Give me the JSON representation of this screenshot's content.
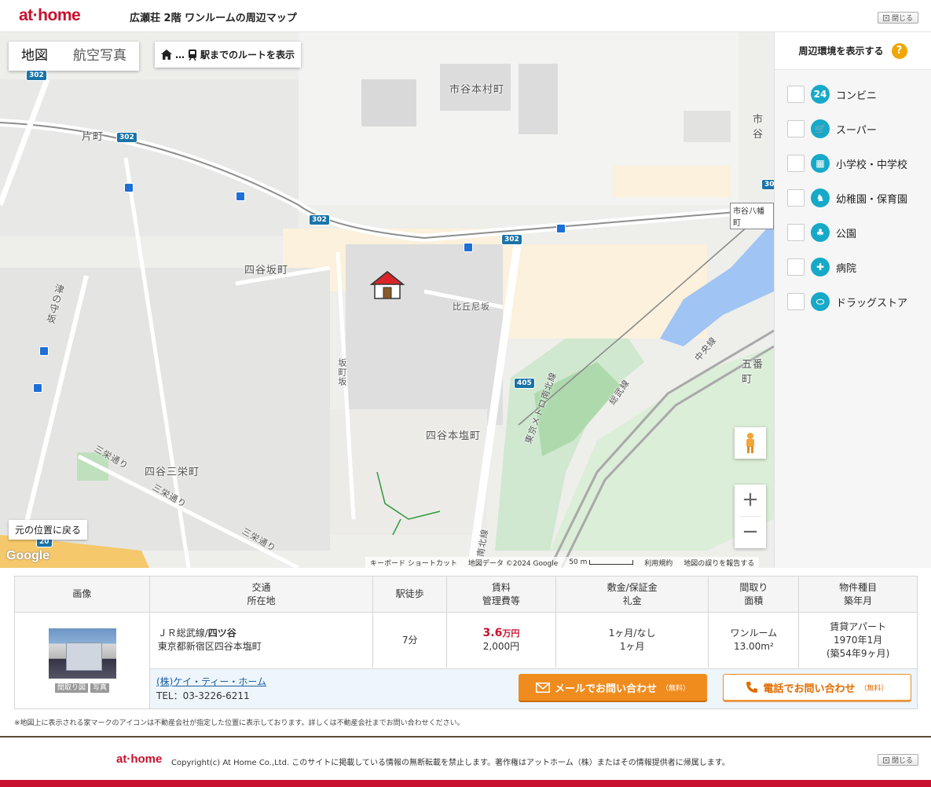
{
  "header": {
    "logo": "at·home",
    "title": "広瀬荘 2階 ワンルームの周辺マップ",
    "close_label": "閉じる"
  },
  "map": {
    "tabs": [
      {
        "label": "地図",
        "active": true
      },
      {
        "label": "航空写真",
        "active": false
      }
    ],
    "route_button": "駅までのルートを表示",
    "labels": {
      "ichigaya_honmura": "市谷本村町",
      "ichigaya": "市谷",
      "katamachi": "片町",
      "yotsuya_sakamachi": "四谷坂町",
      "hikunizaka": "比丘尼坂",
      "sakamachizaka": "坂町坂",
      "tsunokamizaka": "津の守坂",
      "yotsuya_honshiomachi": "四谷本塩町",
      "yotsuya_sanei": "四谷三栄町",
      "saneidori1": "三栄通り",
      "saneidori2": "三栄通り",
      "saneidori3": "三栄通り",
      "gobancho": "五番町",
      "sobu": "総武線",
      "chuo": "中央線",
      "namboku": "東京メトロ南北線",
      "namboku2": "南北線"
    },
    "station_tag": "市谷八幡町",
    "route_shields": [
      "302",
      "302",
      "302",
      "302",
      "405",
      "20",
      "30"
    ],
    "return_button": "元の位置に戻る",
    "google_logo": "Google",
    "attribution": {
      "shortcuts": "キーボード ショートカット",
      "data": "地図データ ©2024 Google",
      "scale": "50 m",
      "terms": "利用規約",
      "report": "地図の誤りを報告する"
    }
  },
  "side_panel": {
    "title": "周辺環境を表示する",
    "help": "?",
    "items": [
      {
        "label": "コンビニ",
        "icon": "convenience-store-icon",
        "checked": false
      },
      {
        "label": "スーパー",
        "icon": "cart-icon",
        "checked": false
      },
      {
        "label": "小学校・中学校",
        "icon": "school-icon",
        "checked": false
      },
      {
        "label": "幼稚園・保育園",
        "icon": "kindergarten-icon",
        "checked": false
      },
      {
        "label": "公園",
        "icon": "tree-icon",
        "checked": false
      },
      {
        "label": "病院",
        "icon": "cross-icon",
        "checked": false
      },
      {
        "label": "ドラッグストア",
        "icon": "pill-icon",
        "checked": false
      }
    ]
  },
  "table": {
    "headers": {
      "image": "画像",
      "access1": "交通",
      "access2": "所在地",
      "walk": "駅徒歩",
      "rent1": "賃料",
      "rent2": "管理費等",
      "deposit1": "敷金/保証金",
      "deposit2": "礼金",
      "layout1": "間取り",
      "layout2": "面積",
      "type1": "物件種目",
      "type2": "築年月"
    },
    "row": {
      "photo_tags": [
        "間取り図",
        "写真"
      ],
      "line_prefix": "ＪＲ総武線/",
      "station": "四ツ谷",
      "address": "東京都新宿区四谷本塩町",
      "walk": "7分",
      "rent_value": "3.6",
      "rent_unit": "万円",
      "mgmt_fee": "2,000円",
      "deposit": "1ヶ月/なし",
      "key_money": "1ヶ月",
      "layout": "ワンルーム",
      "area": "13.00m²",
      "type": "賃貸アパート",
      "built": "1970年1月",
      "age": "(築54年9ヶ月)"
    },
    "agent": {
      "name": "(株)ケイ・ティー・ホーム",
      "tel": "TEL：03-3226-6211",
      "mail_button": "メールでお問い合わせ",
      "tel_button": "電話でお問い合わせ",
      "free": "（無料）"
    }
  },
  "notice": "※地図上に表示される家マークのアイコンは不動産会社が指定した位置に表示しております。詳しくは不動産会社までお問い合わせください。",
  "footer": {
    "logo": "at·home",
    "copyright": "Copyright(c) At Home Co.,Ltd. このサイトに掲載している情報の無断転載を禁止します。著作権はアットホーム（株）またはその情報提供者に帰属します。",
    "close_label": "閉じる"
  },
  "colors": {
    "brand": "#c8102e",
    "orange": "#f08c1e",
    "poi_icon": "#17a9c8",
    "help": "#f0a500"
  }
}
